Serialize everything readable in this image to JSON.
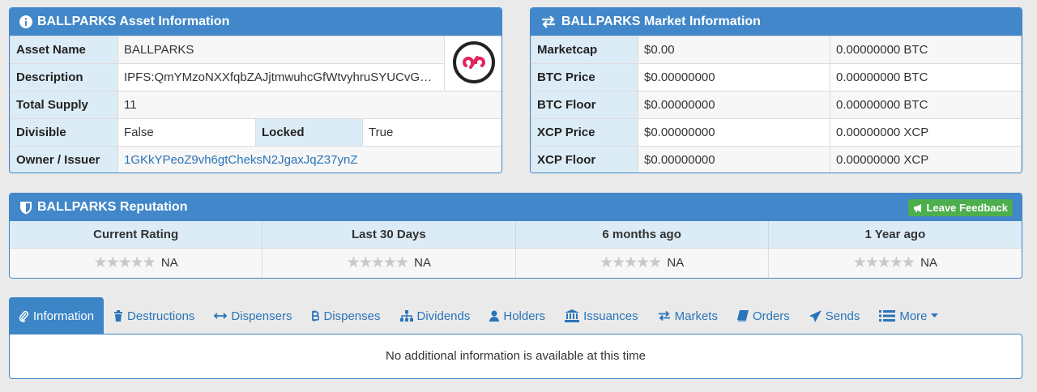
{
  "asset_panel": {
    "title": "BALLPARKS Asset Information",
    "rows": {
      "asset_name": {
        "label": "Asset Name",
        "value": "BALLPARKS"
      },
      "description": {
        "label": "Description",
        "value": "IPFS:QmYMzoNXXfqbZAJjtmwuhcGfWtvyhruSYUCvG…"
      },
      "total_supply": {
        "label": "Total Supply",
        "value": "11"
      },
      "divisible": {
        "label": "Divisible",
        "value": "False"
      },
      "locked": {
        "label": "Locked",
        "value": "True"
      },
      "owner": {
        "label": "Owner / Issuer",
        "value": "1GKkYPeoZ9vh6gtCheksN2JgaxJqZ37ynZ"
      }
    }
  },
  "market_panel": {
    "title": "BALLPARKS Market Information",
    "rows": [
      {
        "label": "Marketcap",
        "usd": "$0.00",
        "alt": "0.00000000 BTC"
      },
      {
        "label": "BTC Price",
        "usd": "$0.00000000",
        "alt": "0.00000000 BTC"
      },
      {
        "label": "BTC Floor",
        "usd": "$0.00000000",
        "alt": "0.00000000 BTC"
      },
      {
        "label": "XCP Price",
        "usd": "$0.00000000",
        "alt": "0.00000000 XCP"
      },
      {
        "label": "XCP Floor",
        "usd": "$0.00000000",
        "alt": "0.00000000 XCP"
      }
    ]
  },
  "reputation_panel": {
    "title": "BALLPARKS Reputation",
    "feedback_label": "Leave Feedback",
    "columns": [
      {
        "header": "Current Rating",
        "value": "NA",
        "stars": 0
      },
      {
        "header": "Last 30 Days",
        "value": "NA",
        "stars": 0
      },
      {
        "header": "6 months ago",
        "value": "NA",
        "stars": 0
      },
      {
        "header": "1 Year ago",
        "value": "NA",
        "stars": 0
      }
    ]
  },
  "tabs": [
    {
      "label": "Information",
      "icon": "paperclip-icon",
      "active": true
    },
    {
      "label": "Destructions",
      "icon": "trash-icon"
    },
    {
      "label": "Dispensers",
      "icon": "arrows-horizontal-icon"
    },
    {
      "label": "Dispenses",
      "icon": "bitcoin-icon"
    },
    {
      "label": "Dividends",
      "icon": "sitemap-icon"
    },
    {
      "label": "Holders",
      "icon": "user-icon"
    },
    {
      "label": "Issuances",
      "icon": "bank-icon"
    },
    {
      "label": "Markets",
      "icon": "exchange-icon"
    },
    {
      "label": "Orders",
      "icon": "book-icon"
    },
    {
      "label": "Sends",
      "icon": "paper-plane-icon"
    },
    {
      "label": "More",
      "icon": "list-icon"
    }
  ],
  "tab_content": "No additional information is available at this time",
  "colors": {
    "accent": "#4187c9",
    "label_bg": "#dcecf7",
    "link": "#2a74b9",
    "feedback": "#4cae4c",
    "logo": "#e0245e"
  }
}
